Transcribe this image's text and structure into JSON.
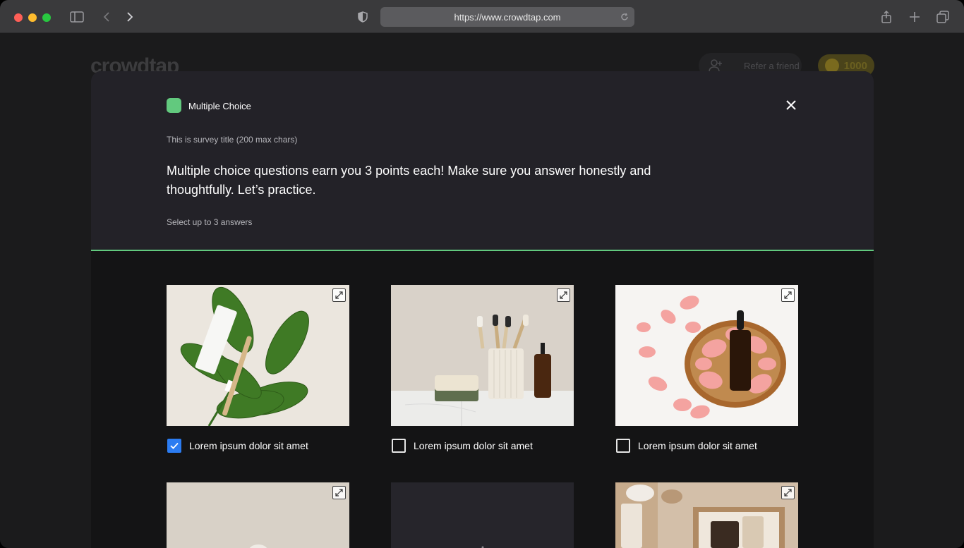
{
  "browser": {
    "url": "https://www.crowdtap.com"
  },
  "background_page": {
    "logo": "crowdtap",
    "refer_label": "Refer a friend",
    "points": "1000"
  },
  "modal": {
    "type_label": "Multiple Choice",
    "survey_title": "This is survey title (200 max chars)",
    "question": "Multiple choice questions earn you 3 points each! Make sure you answer honestly and thoughtfully. Let’s practice.",
    "hint": "Select up to 3 answers",
    "accent_color": "#62c97e",
    "checkbox_color": "#2b7cf1",
    "options": [
      {
        "label": "Lorem ipsum dolor sit amet",
        "checked": true
      },
      {
        "label": "Lorem ipsum dolor sit amet",
        "checked": false
      },
      {
        "label": "Lorem ipsum dolor sit amet",
        "checked": false
      }
    ]
  }
}
